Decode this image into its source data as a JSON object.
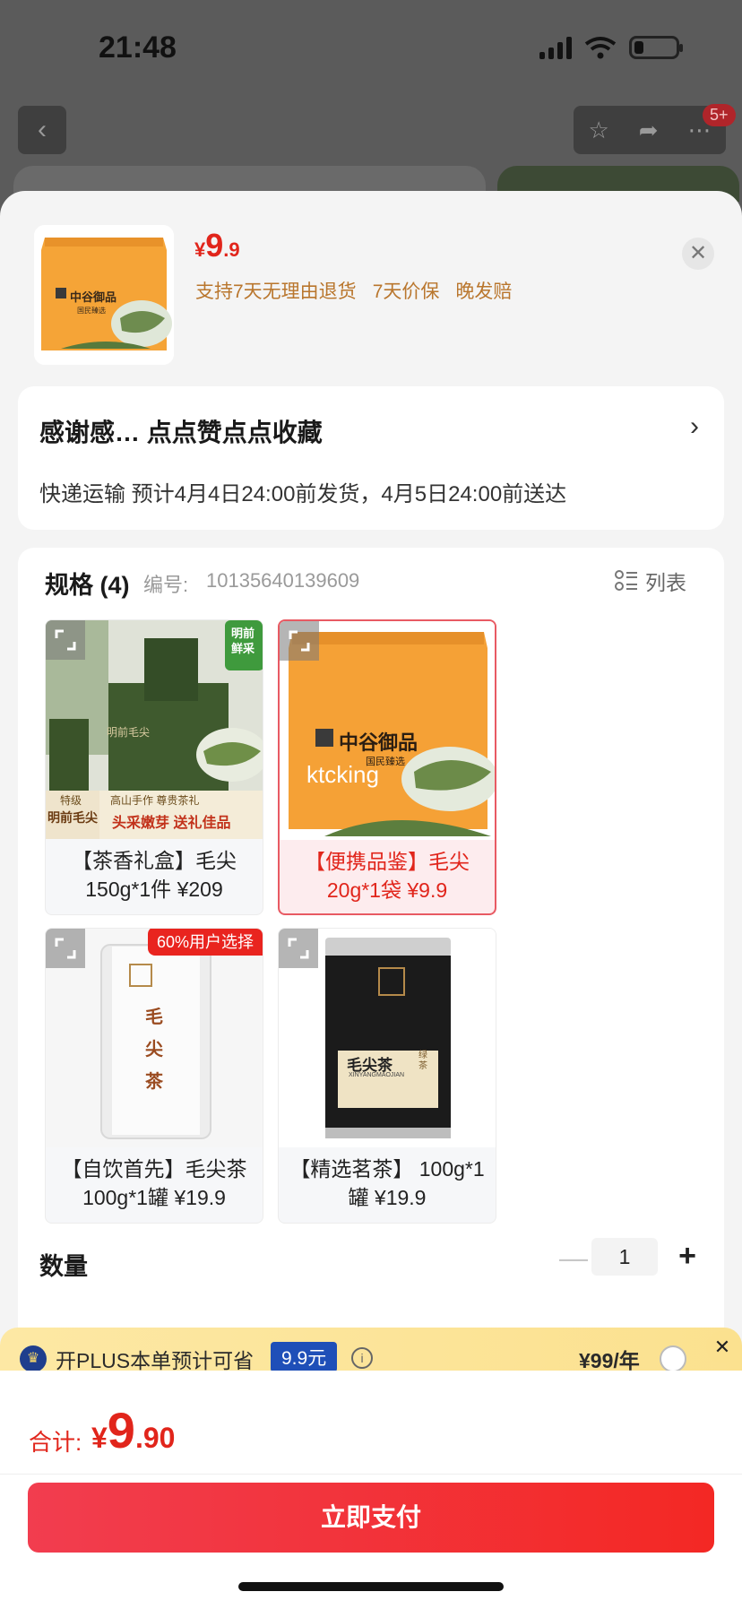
{
  "status": {
    "time": "21:48"
  },
  "header": {
    "badge": "5+"
  },
  "product": {
    "price_currency": "¥",
    "price_int": "9",
    "price_dec": ".9",
    "services": [
      "支持7天无理由退货",
      "7天价保",
      "晚发赔"
    ],
    "thumb_brand": "中谷御品",
    "thumb_sub": "国民臻选"
  },
  "address": {
    "title": "感谢感… 点点赞点点收藏",
    "delivery": "快递运输 预计4月4日24:00前发货，4月5日24:00前送达"
  },
  "spec": {
    "title": "规格 (4)",
    "code_label": "编号:",
    "code": "10135640139609",
    "list_label": "列表",
    "items": [
      {
        "label": "【茶香礼盒】毛尖150g*1件 ¥209",
        "tag_top": "明前",
        "tag_bottom": "鲜采",
        "box_text": "明前毛尖",
        "banner_grade": "特级",
        "banner_name": "明前毛尖",
        "banner_line1": "高山手作 尊贵茶礼",
        "banner_line2": "头采嫩芽 送礼佳品"
      },
      {
        "label": "【便携品鉴】毛尖20g*1袋 ¥9.9",
        "brand": "中谷御品",
        "sub": "国民臻选",
        "watermark": "ktcking"
      },
      {
        "label": "【自饮首先】毛尖茶100g*1罐 ¥19.9",
        "badge": "60%用户选择",
        "can_text": "毛尖茶"
      },
      {
        "label": "【精选茗茶】 100g*1罐 ¥19.9",
        "can_text": "毛尖茶",
        "can_sub": "XINYANGMAOJIAN",
        "can_green": "绿茶"
      }
    ]
  },
  "quantity": {
    "label": "数量",
    "value": "1",
    "minus": "—",
    "plus": "+"
  },
  "plus_bar": {
    "text": "开PLUS本单预计可省",
    "save": "9.9元",
    "price": "¥99/年"
  },
  "total": {
    "label": "合计:",
    "currency": "¥",
    "int": "9",
    "dec": ".90"
  },
  "pay_button": "立即支付",
  "colors": {
    "accent": "#e1251b",
    "service": "#b9762d",
    "plus_blue": "#1f4fb8"
  }
}
